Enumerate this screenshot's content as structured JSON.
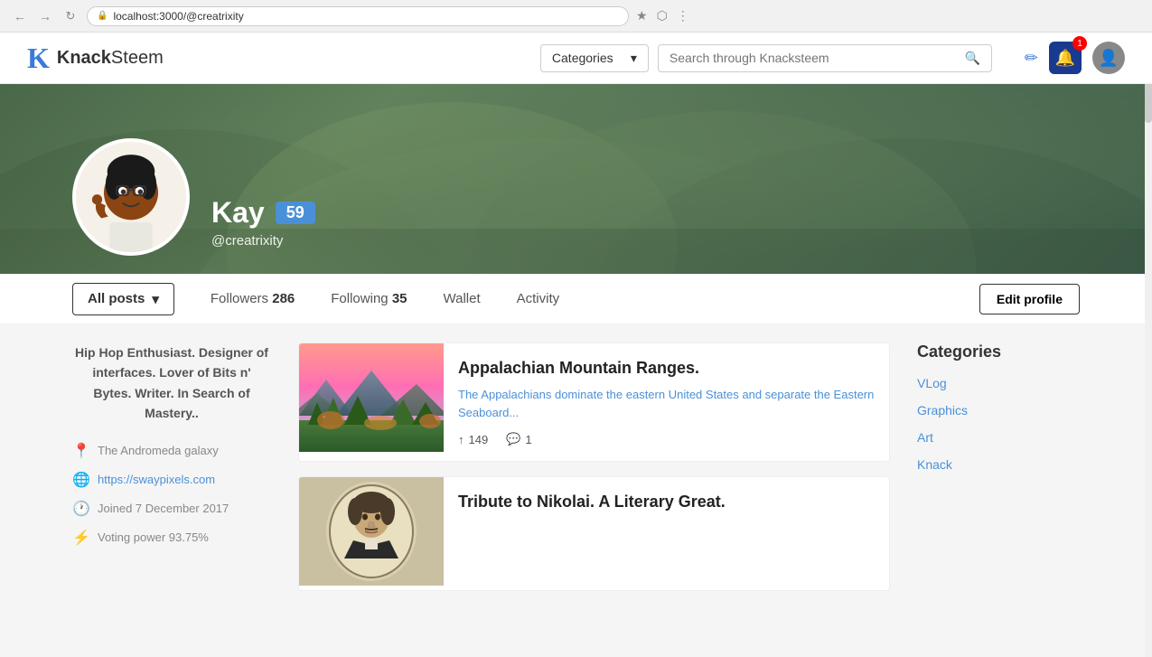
{
  "browser": {
    "back_btn": "←",
    "forward_btn": "→",
    "reload_btn": "↻",
    "url": "localhost:3000/@creatrixity",
    "star_icon": "★",
    "extension_icon": "⬡",
    "menu_icon": "⋮"
  },
  "navbar": {
    "logo_k": "K",
    "logo_brand": "Knack",
    "logo_suffix": "Steem",
    "categories_label": "Categories",
    "search_placeholder": "Search through Knacksteem",
    "edit_icon": "✏",
    "bell_icon": "🔔",
    "notification_count": "1"
  },
  "cover": {
    "profile_name": "Kay",
    "reputation": "59",
    "handle": "@creatrixity"
  },
  "tabs": {
    "all_posts": "All posts",
    "followers_label": "Followers",
    "followers_count": "286",
    "following_label": "Following",
    "following_count": "35",
    "wallet": "Wallet",
    "activity": "Activity",
    "edit_profile": "Edit profile"
  },
  "sidebar": {
    "bio": "Hip Hop Enthusiast. Designer of interfaces. Lover of Bits n' Bytes. Writer. In Search of Mastery..",
    "location_icon": "📍",
    "location": "The Andromeda galaxy",
    "website_icon": "🌐",
    "website_url": "https://swaypixels.com",
    "joined_icon": "🕐",
    "joined": "Joined 7 December 2017",
    "voting_icon": "⚡",
    "voting_power_label": "Voting power 93.75%"
  },
  "posts": [
    {
      "id": 1,
      "title": "Appalachian Mountain Ranges.",
      "excerpt": "The Appalachians dominate the eastern United States and separate the Eastern Seaboard...",
      "upvotes": "149",
      "comments": "1",
      "has_mountain_image": true
    },
    {
      "id": 2,
      "title": "Tribute to Nikolai. A Literary Great.",
      "excerpt": "",
      "upvotes": "",
      "comments": "",
      "has_portrait_image": true
    }
  ],
  "right_sidebar": {
    "categories_title": "Categories",
    "categories": [
      {
        "name": "VLog"
      },
      {
        "name": "Graphics"
      },
      {
        "name": "Art"
      },
      {
        "name": "Knack"
      }
    ]
  }
}
